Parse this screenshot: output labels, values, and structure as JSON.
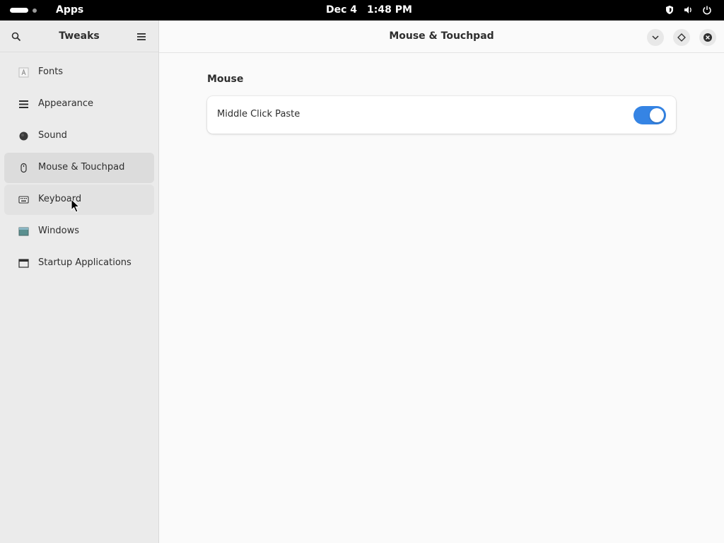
{
  "topbar": {
    "activities_label": "Apps",
    "date": "Dec 4",
    "time": "1:48 PM",
    "tray_icons": [
      "shield-icon",
      "volume-icon",
      "power-icon"
    ]
  },
  "sidebar": {
    "title": "Tweaks",
    "items": [
      {
        "label": "Fonts",
        "icon": "fonts-icon"
      },
      {
        "label": "Appearance",
        "icon": "appearance-icon"
      },
      {
        "label": "Sound",
        "icon": "sound-icon"
      },
      {
        "label": "Mouse & Touchpad",
        "icon": "mouse-icon",
        "selected": true
      },
      {
        "label": "Keyboard",
        "icon": "keyboard-icon",
        "hovered": true
      },
      {
        "label": "Windows",
        "icon": "windows-icon"
      },
      {
        "label": "Startup Applications",
        "icon": "startup-icon"
      }
    ]
  },
  "main": {
    "title": "Mouse & Touchpad",
    "window_buttons": [
      "minimize-icon",
      "maximize-icon",
      "close-icon"
    ],
    "sections": [
      {
        "title": "Mouse",
        "rows": [
          {
            "label": "Middle Click Paste",
            "enabled": true
          }
        ]
      }
    ]
  },
  "colors": {
    "accent": "#3584e4",
    "sidebar_bg": "#ebebeb",
    "content_bg": "#fafafa",
    "topbar_bg": "#000000"
  }
}
